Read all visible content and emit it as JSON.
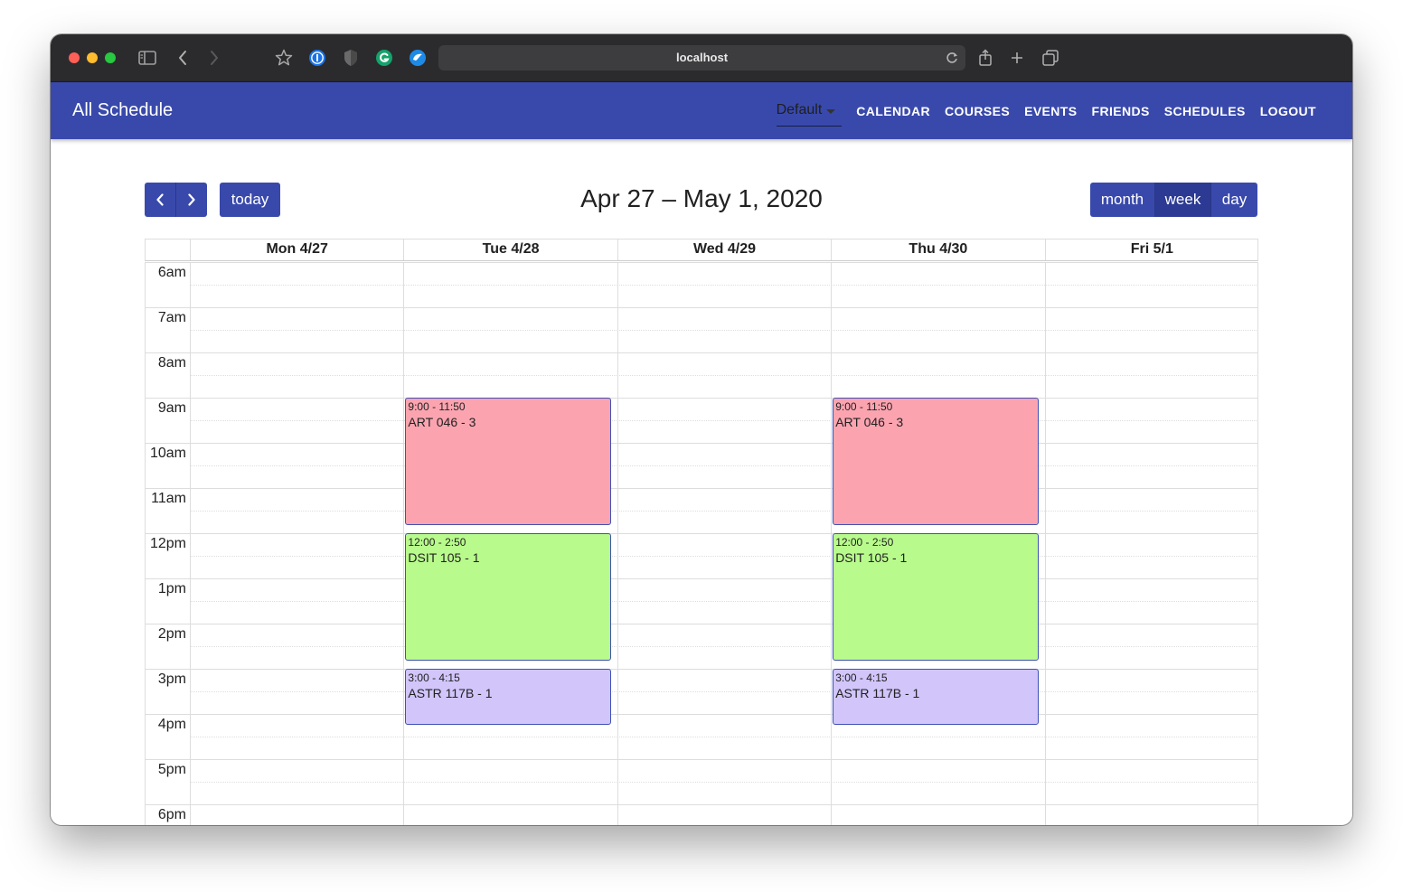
{
  "browser": {
    "url": "localhost",
    "icons": [
      "sidebar-icon",
      "back-icon",
      "forward-icon",
      "star-icon",
      "password-manager-icon",
      "shield-icon",
      "grammarly-icon",
      "extension-icon",
      "reload-icon",
      "share-icon",
      "new-tab-icon",
      "tabs-icon"
    ]
  },
  "app": {
    "title": "All Schedule",
    "schedule_select": "Default",
    "nav": [
      "CALENDAR",
      "COURSES",
      "EVENTS",
      "FRIENDS",
      "SCHEDULES",
      "LOGOUT"
    ]
  },
  "calendar": {
    "title": "Apr 27 – May 1, 2020",
    "today_label": "today",
    "views": [
      "month",
      "week",
      "day"
    ],
    "active_view": "week",
    "days": [
      "Mon 4/27",
      "Tue 4/28",
      "Wed 4/29",
      "Thu 4/30",
      "Fri 5/1"
    ],
    "hours": [
      "6am",
      "7am",
      "8am",
      "9am",
      "10am",
      "11am",
      "12pm",
      "1pm",
      "2pm",
      "3pm",
      "4pm",
      "5pm",
      "6pm"
    ],
    "events": [
      {
        "day": 1,
        "start": 9.0,
        "end": 11.833,
        "time": "9:00 - 11:50",
        "title": "ART 046 - 3",
        "color": "#fba4b0"
      },
      {
        "day": 1,
        "start": 12.0,
        "end": 14.833,
        "time": "12:00 - 2:50",
        "title": "DSIT 105 - 1",
        "color": "#b8fb8c"
      },
      {
        "day": 1,
        "start": 15.0,
        "end": 16.25,
        "time": "3:00 - 4:15",
        "title": "ASTR 117B - 1",
        "color": "#d1c5fa"
      },
      {
        "day": 3,
        "start": 9.0,
        "end": 11.833,
        "time": "9:00 - 11:50",
        "title": "ART 046 - 3",
        "color": "#fba4b0"
      },
      {
        "day": 3,
        "start": 12.0,
        "end": 14.833,
        "time": "12:00 - 2:50",
        "title": "DSIT 105 - 1",
        "color": "#b8fb8c"
      },
      {
        "day": 3,
        "start": 15.0,
        "end": 16.25,
        "time": "3:00 - 4:15",
        "title": "ASTR 117B - 1",
        "color": "#d1c5fa"
      }
    ]
  }
}
